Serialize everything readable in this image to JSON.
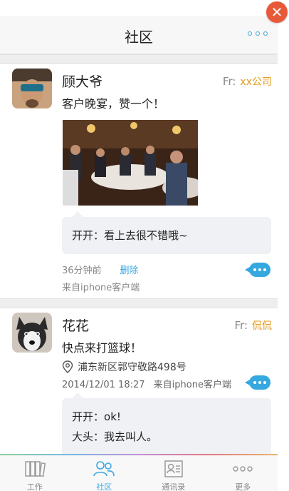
{
  "header": {
    "title": "社区"
  },
  "posts": [
    {
      "name": "顾大爷",
      "from_prefix": "Fr:",
      "from_org": "xx公司",
      "text": "客户晚宴，赞一个！",
      "comments": [
        {
          "author": "开开",
          "sep": "：",
          "text": "看上去很不错哦~"
        }
      ],
      "time": "36分钟前",
      "delete_label": "删除",
      "source": "来自iphone客户端"
    },
    {
      "name": "花花",
      "from_prefix": "Fr:",
      "from_org": "侃侃",
      "text": "快点来打篮球！",
      "location": "浦东新区郭守敬路498号",
      "time": "2014/12/01 18:27",
      "source": "来自iphone客户端",
      "comments": [
        {
          "author": "开开",
          "sep": "：",
          "text": "ok!"
        },
        {
          "author": "大头",
          "sep": "：",
          "text": "我去叫人。"
        }
      ]
    }
  ],
  "tabbar": {
    "items": [
      {
        "label": "工作",
        "icon": "work-icon",
        "active": false
      },
      {
        "label": "社区",
        "icon": "community-icon",
        "active": true
      },
      {
        "label": "通讯录",
        "icon": "contacts-icon",
        "active": false
      },
      {
        "label": "更多",
        "icon": "more-icon",
        "active": false
      }
    ]
  },
  "colors": {
    "accent": "#3aa7e0",
    "org": "#e29a1c",
    "close": "#e8593a"
  }
}
